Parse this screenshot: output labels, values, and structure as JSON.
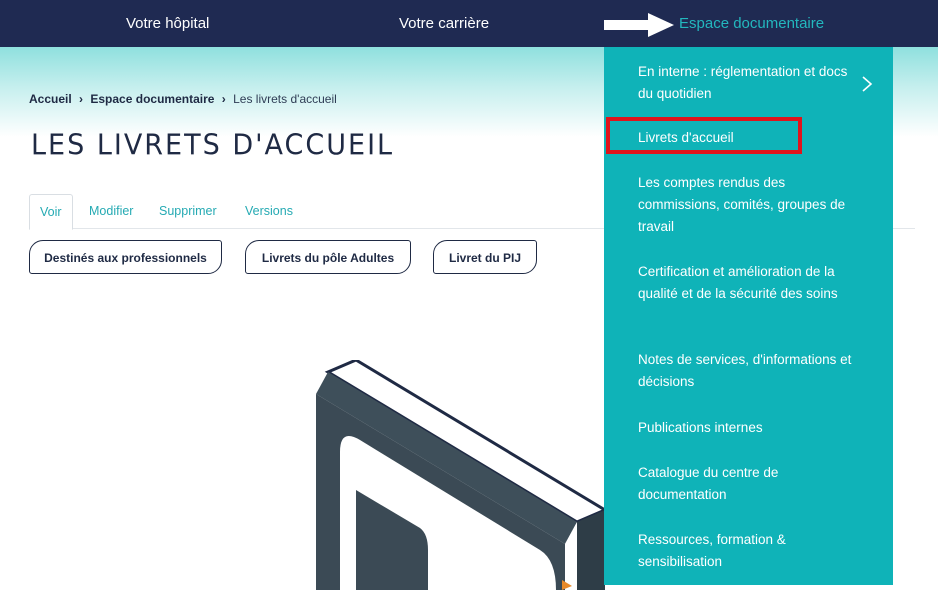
{
  "topnav": {
    "items": [
      {
        "label": "Votre hôpital"
      },
      {
        "label": "Votre carrière"
      },
      {
        "label": "Espace documentaire"
      }
    ]
  },
  "breadcrumb": {
    "home": "Accueil",
    "section": "Espace documentaire",
    "current": "Les livrets d'accueil"
  },
  "page": {
    "title": "LES LIVRETS D'ACCUEIL"
  },
  "tabs": [
    {
      "label": "Voir"
    },
    {
      "label": "Modifier"
    },
    {
      "label": "Supprimer"
    },
    {
      "label": "Versions"
    }
  ],
  "filters": [
    {
      "label": "Destinés aux professionnels"
    },
    {
      "label": "Livrets du pôle Adultes"
    },
    {
      "label": "Livret du PIJ"
    }
  ],
  "dropdown": {
    "items": [
      {
        "label": "En interne : réglementation et docs du quotidien"
      },
      {
        "label": "Livrets d'accueil"
      },
      {
        "label": "Les comptes rendus des commissions, comités, groupes de travail"
      },
      {
        "label": "Certification et amélioration de la qualité et de la sécurité des soins"
      },
      {
        "label": "Notes de services, d'informations et décisions"
      },
      {
        "label": "Publications internes"
      },
      {
        "label": "Catalogue du centre de documentation"
      },
      {
        "label": "Ressources, formation & sensibilisation"
      }
    ]
  },
  "colors": {
    "navy": "#1f2a52",
    "teal": "#0fb3b8",
    "accent_text": "#23b7be",
    "highlight": "#e0141c"
  }
}
